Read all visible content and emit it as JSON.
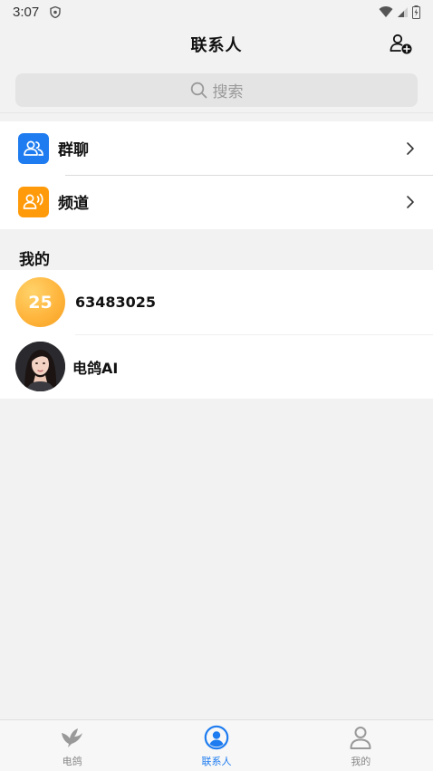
{
  "status_bar": {
    "time": "3:07"
  },
  "header": {
    "title": "联系人",
    "add_icon": "add-contact-icon"
  },
  "search": {
    "placeholder": "搜索",
    "icon": "search-icon"
  },
  "menu": [
    {
      "label": "群聊",
      "icon": "group-chat-icon",
      "color": "#1e7cf0"
    },
    {
      "label": "频道",
      "icon": "channel-icon",
      "color": "#ff9a0a"
    }
  ],
  "section": {
    "title": "我的"
  },
  "contacts": [
    {
      "name": "63483025",
      "avatar_text": "25"
    },
    {
      "name": "电鸽AI",
      "avatar": "portrait-avatar"
    }
  ],
  "bottom_nav": {
    "items": [
      {
        "label": "电鸽",
        "icon": "dove-icon",
        "active": false
      },
      {
        "label": "联系人",
        "icon": "contacts-icon",
        "active": true
      },
      {
        "label": "我的",
        "icon": "profile-icon",
        "active": false
      }
    ]
  },
  "colors": {
    "accent": "#1e7cf0",
    "orange": "#ff9a0a",
    "inactive": "#888888"
  }
}
